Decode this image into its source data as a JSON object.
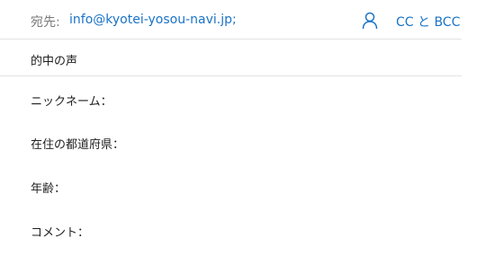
{
  "to": {
    "label": "宛先:",
    "address": "info@kyotei-yosou-navi.jp;",
    "person_icon": "person-icon",
    "cc_bcc_label": "CC と BCC"
  },
  "subject": {
    "value": "的中の声"
  },
  "body": {
    "lines": [
      "ニックネーム：",
      "在住の都道府県：",
      "年齢：",
      "コメント："
    ]
  },
  "colors": {
    "link": "#1a73c7",
    "label": "#7a7a7a",
    "text": "#1f1f1f"
  }
}
